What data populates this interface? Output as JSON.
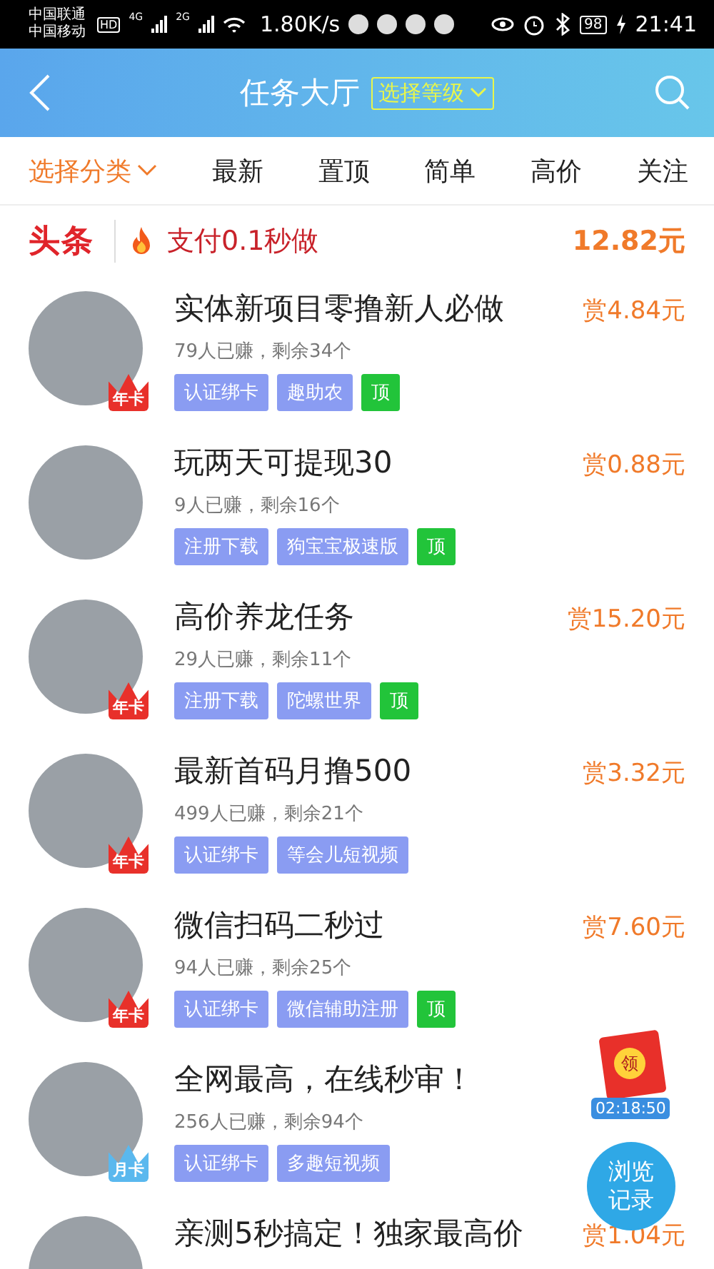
{
  "status_bar": {
    "carriers": [
      "中国联通",
      "中国移动"
    ],
    "hd": "HD",
    "networks": [
      "4G",
      "2G"
    ],
    "speed": "1.80K/s",
    "battery": "98",
    "time": "21:41"
  },
  "header": {
    "title": "任务大厅",
    "level_filter": "选择等级"
  },
  "tabs": [
    {
      "label": "选择分类",
      "selected": true,
      "dropdown": true
    },
    {
      "label": "最新",
      "selected": false,
      "dropdown": false
    },
    {
      "label": "置顶",
      "selected": false,
      "dropdown": false
    },
    {
      "label": "简单",
      "selected": false,
      "dropdown": false
    },
    {
      "label": "高价",
      "selected": false,
      "dropdown": false
    },
    {
      "label": "关注",
      "selected": false,
      "dropdown": false
    }
  ],
  "headline": {
    "brand": "头条",
    "text": "支付0.1秒做",
    "amount": "12.82元"
  },
  "tasks": [
    {
      "title": "实体新项目零撸新人必做",
      "reward": "赏4.84元",
      "stats": "79人已赚，剩余34个",
      "badge": {
        "label": "年卡",
        "kind": "year"
      },
      "tags": [
        {
          "label": "认证绑卡",
          "kind": "category"
        },
        {
          "label": "趣助农",
          "kind": "category"
        },
        {
          "label": "顶",
          "kind": "top"
        }
      ]
    },
    {
      "title": "玩两天可提现30",
      "reward": "赏0.88元",
      "stats": "9人已赚，剩余16个",
      "tags": [
        {
          "label": "注册下载",
          "kind": "category"
        },
        {
          "label": "狗宝宝极速版",
          "kind": "category"
        },
        {
          "label": "顶",
          "kind": "top"
        }
      ]
    },
    {
      "title": "高价养龙任务",
      "reward": "赏15.20元",
      "stats": "29人已赚，剩余11个",
      "badge": {
        "label": "年卡",
        "kind": "year"
      },
      "tags": [
        {
          "label": "注册下载",
          "kind": "category"
        },
        {
          "label": "陀螺世界",
          "kind": "category"
        },
        {
          "label": "顶",
          "kind": "top"
        }
      ]
    },
    {
      "title": "最新首码月撸500",
      "reward": "赏3.32元",
      "stats": "499人已赚，剩余21个",
      "badge": {
        "label": "年卡",
        "kind": "year"
      },
      "tags": [
        {
          "label": "认证绑卡",
          "kind": "category"
        },
        {
          "label": "等会儿短视频",
          "kind": "category"
        }
      ]
    },
    {
      "title": "微信扫码二秒过",
      "reward": "赏7.60元",
      "stats": "94人已赚，剩余25个",
      "badge": {
        "label": "年卡",
        "kind": "year"
      },
      "tags": [
        {
          "label": "认证绑卡",
          "kind": "category"
        },
        {
          "label": "微信辅助注册",
          "kind": "category"
        },
        {
          "label": "顶",
          "kind": "top"
        }
      ]
    },
    {
      "title": "全网最高，在线秒审！",
      "stats": "256人已赚，剩余94个",
      "badge": {
        "label": "月卡",
        "kind": "month"
      },
      "tags": [
        {
          "label": "认证绑卡",
          "kind": "category"
        },
        {
          "label": "多趣短视频",
          "kind": "category"
        }
      ]
    },
    {
      "title": "亲测5秒搞定！独家最高价",
      "reward": "赏1.04元"
    }
  ],
  "red_packet": {
    "label": "领",
    "timer": "02:18:50"
  },
  "history_button": {
    "label": "浏览记录"
  }
}
